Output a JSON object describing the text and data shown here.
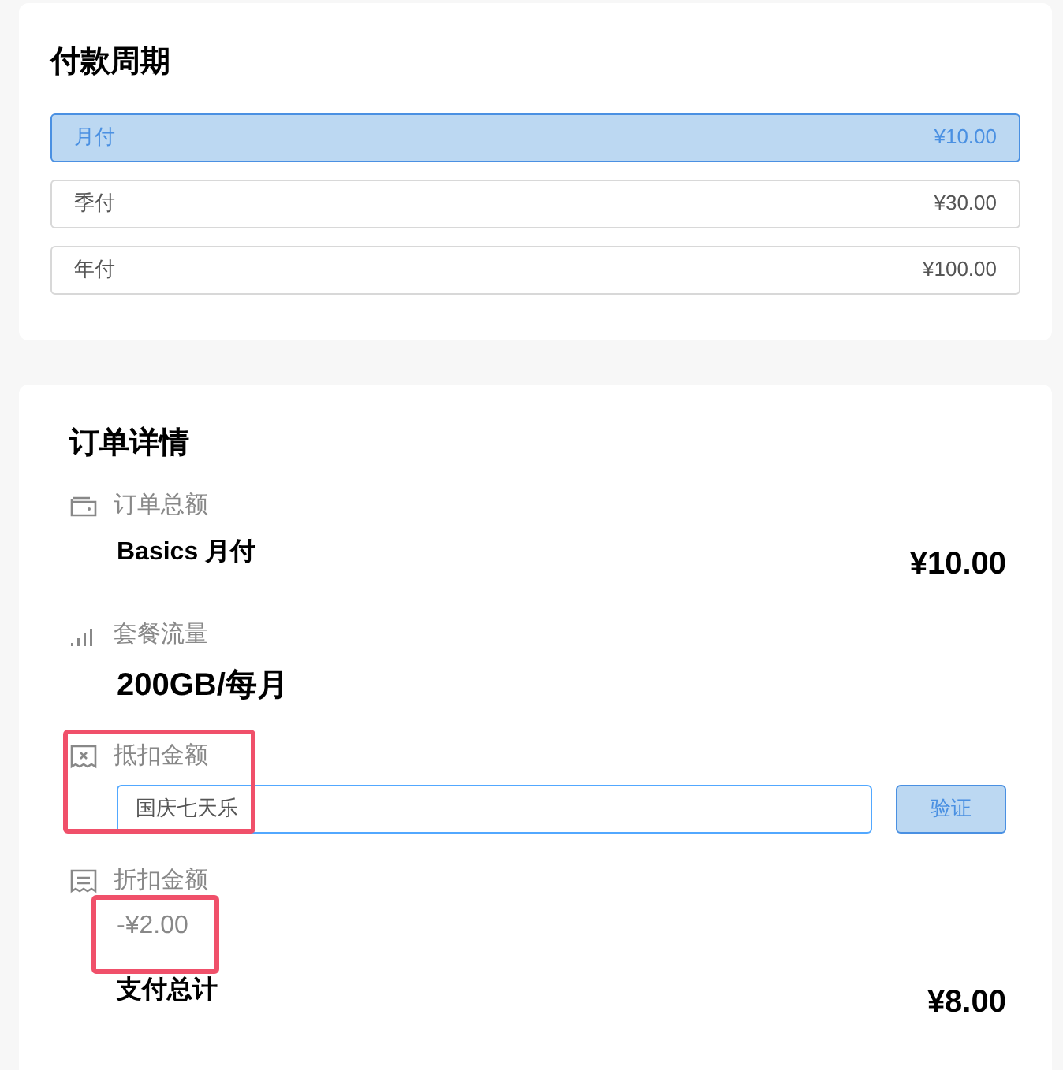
{
  "billing_cycle": {
    "title": "付款周期",
    "options": [
      {
        "label": "月付",
        "price": "¥10.00",
        "selected": true
      },
      {
        "label": "季付",
        "price": "¥30.00",
        "selected": false
      },
      {
        "label": "年付",
        "price": "¥100.00",
        "selected": false
      }
    ]
  },
  "order_details": {
    "title": "订单详情",
    "items": [
      {
        "kind": "amount",
        "label": "订单总额",
        "name": "Basics 月付",
        "value": "¥10.00"
      },
      {
        "kind": "plain",
        "label": "套餐流量",
        "value": "200GB/每月"
      },
      {
        "kind": "coupon",
        "label": "抵扣金额",
        "value": "国庆七天乐",
        "button": "验证"
      },
      {
        "kind": "discount",
        "label": "折扣金额",
        "value": "-¥2.00"
      }
    ],
    "total": {
      "label": "支付总计",
      "value": "¥8.00"
    }
  }
}
